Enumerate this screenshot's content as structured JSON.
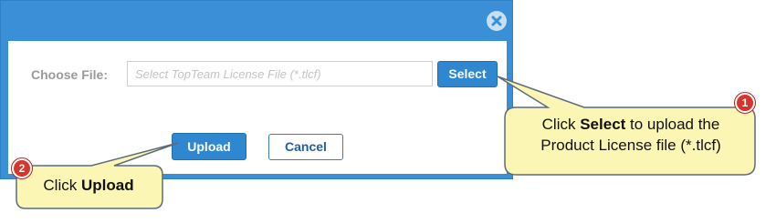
{
  "dialog": {
    "choose_file_label": "Choose File:",
    "file_placeholder": "Select TopTeam License File (*.tlcf)",
    "select_label": "Select",
    "upload_label": "Upload",
    "cancel_label": "Cancel",
    "close_icon": "close-circle-icon"
  },
  "callouts": [
    {
      "number": "1",
      "text_prefix": "Click ",
      "bold": "Select",
      "text_line1_suffix": " to upload the",
      "text_line2": "Product License file (*.tlcf)"
    },
    {
      "number": "2",
      "text_prefix": "Click ",
      "bold": "Upload"
    }
  ],
  "colors": {
    "dialog_frame": "#3a8fd6",
    "button_blue": "#2f87cf",
    "callout_fill": "#fbf6b4",
    "callout_border": "#5c6b7a",
    "badge_red": "#d9342b"
  }
}
